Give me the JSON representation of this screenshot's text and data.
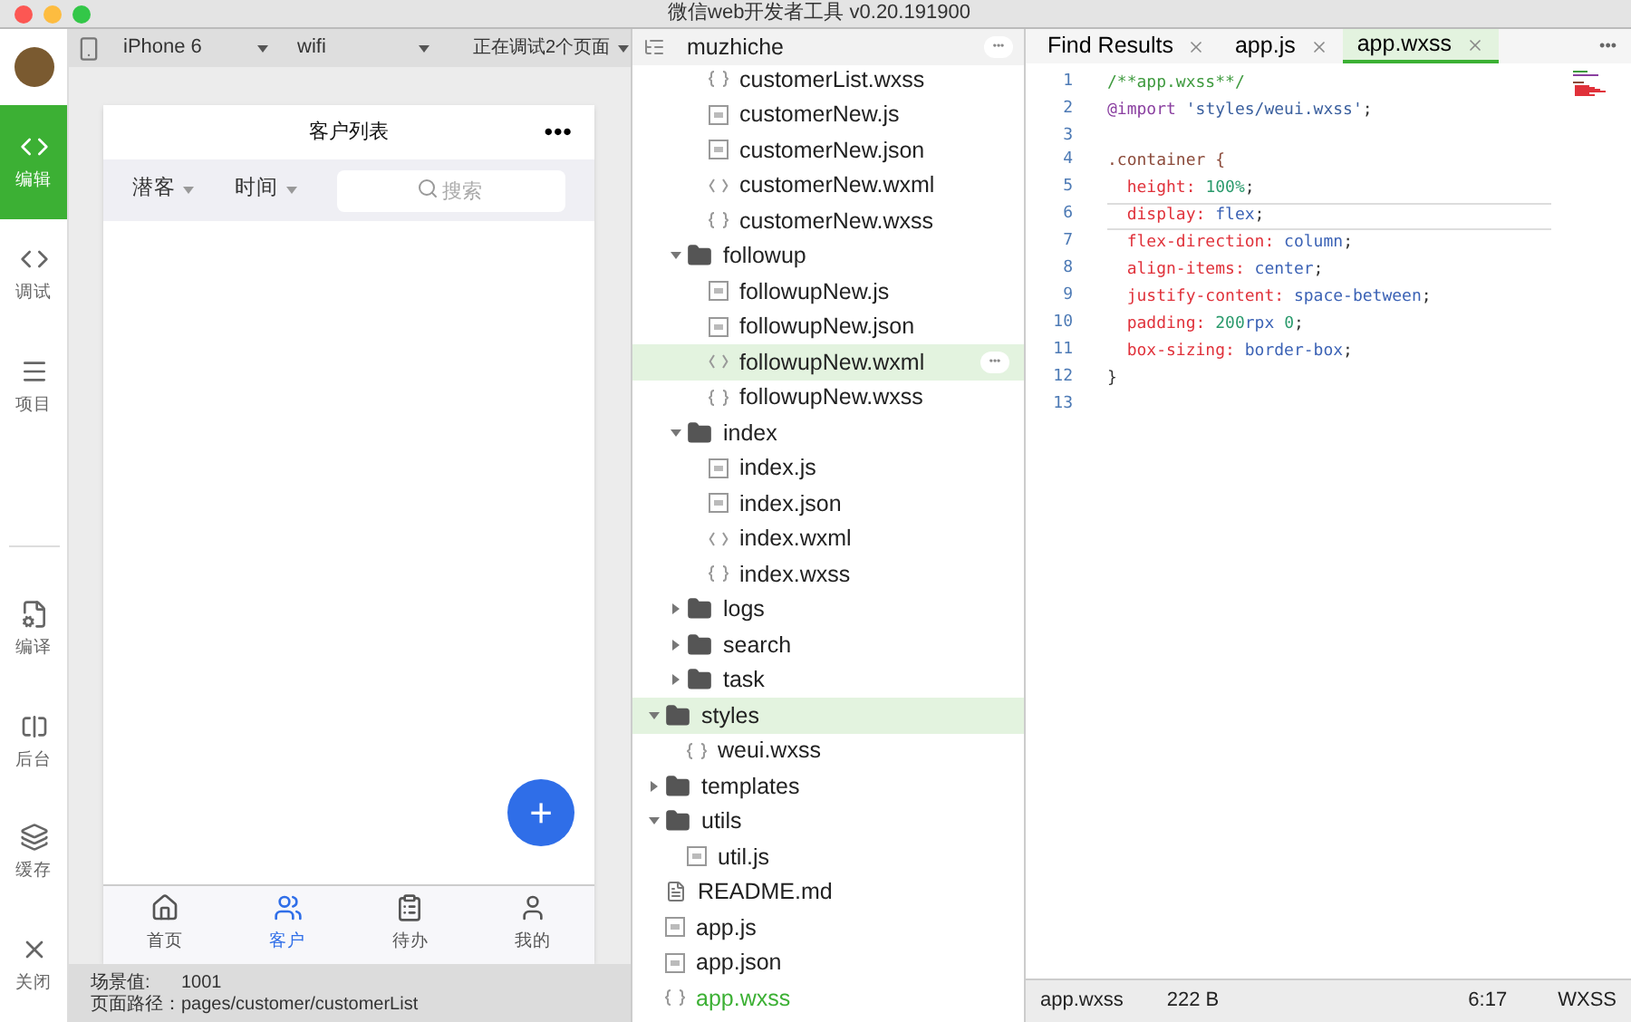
{
  "window": {
    "title": "微信web开发者工具 v0.20.191900"
  },
  "sidebar": {
    "items": [
      {
        "kind": "edit",
        "label": "编辑",
        "selected": true
      },
      {
        "kind": "debug",
        "label": "调试",
        "selected": false
      },
      {
        "kind": "project",
        "label": "项目",
        "selected": false
      },
      {
        "kind": "compile",
        "label": "编译",
        "selected": false
      },
      {
        "kind": "backend",
        "label": "后台",
        "selected": false
      },
      {
        "kind": "cache",
        "label": "缓存",
        "selected": false
      },
      {
        "kind": "close",
        "label": "关闭",
        "selected": false
      }
    ]
  },
  "simulator": {
    "device": "iPhone 6",
    "network": "wifi",
    "debug_pages": "正在调试2个页面",
    "page_title": "客户列表",
    "menu": "•••",
    "filters": [
      {
        "label": "潜客"
      },
      {
        "label": "时间"
      }
    ],
    "search": {
      "placeholder": "搜索"
    },
    "fab": "+",
    "tabbar": [
      {
        "kind": "home",
        "label": "首页",
        "selected": false
      },
      {
        "kind": "customers",
        "label": "客户",
        "selected": true
      },
      {
        "kind": "todo",
        "label": "待办",
        "selected": false
      },
      {
        "kind": "me",
        "label": "我的",
        "selected": false
      }
    ],
    "scene_label": "场景值:",
    "scene_value": "1001",
    "path_label": "页面路径：",
    "path_value": "pages/customer/customerList"
  },
  "file_tree": {
    "project": "muzhiche",
    "more": "•••",
    "items": [
      {
        "children": [
          {
            "children": [
              {
                "name": "customerList.wxss",
                "kind": "wxss",
                "selected": false
              },
              {
                "name": "customerNew.js",
                "kind": "js",
                "selected": false
              },
              {
                "name": "customerNew.json",
                "kind": "json",
                "selected": false
              },
              {
                "name": "customerNew.wxml",
                "kind": "wxml",
                "selected": false
              },
              {
                "name": "customerNew.wxss",
                "kind": "wxss",
                "selected": false
              }
            ]
          },
          {
            "name": "followup",
            "kind": "folder",
            "expanded": true,
            "selected": false,
            "children": [
              {
                "name": "followupNew.js",
                "kind": "js",
                "selected": false
              },
              {
                "name": "followupNew.json",
                "kind": "json",
                "selected": false
              },
              {
                "name": "followupNew.wxml",
                "kind": "wxml",
                "selected": true,
                "more": "•••"
              },
              {
                "name": "followupNew.wxss",
                "kind": "wxss",
                "selected": false
              }
            ]
          },
          {
            "name": "index",
            "kind": "folder",
            "expanded": true,
            "selected": false,
            "children": [
              {
                "name": "index.js",
                "kind": "js",
                "selected": false
              },
              {
                "name": "index.json",
                "kind": "json",
                "selected": false
              },
              {
                "name": "index.wxml",
                "kind": "wxml",
                "selected": false
              },
              {
                "name": "index.wxss",
                "kind": "wxss",
                "selected": false
              }
            ]
          },
          {
            "name": "logs",
            "kind": "folder",
            "expanded": false,
            "selected": false
          },
          {
            "name": "search",
            "kind": "folder",
            "expanded": false,
            "selected": false
          },
          {
            "name": "task",
            "kind": "folder",
            "expanded": false,
            "selected": false
          }
        ]
      },
      {
        "name": "styles",
        "kind": "folder",
        "expanded": true,
        "selected": true,
        "children": [
          {
            "name": "weui.wxss",
            "kind": "wxss",
            "selected": false
          }
        ]
      },
      {
        "name": "templates",
        "kind": "folder",
        "expanded": false,
        "selected": false
      },
      {
        "name": "utils",
        "kind": "folder",
        "expanded": true,
        "selected": false,
        "children": [
          {
            "name": "util.js",
            "kind": "js",
            "selected": false
          }
        ]
      },
      {
        "name": "README.md",
        "kind": "md",
        "selected": false
      },
      {
        "name": "app.js",
        "kind": "js",
        "selected": false
      },
      {
        "name": "app.json",
        "kind": "json",
        "selected": false
      },
      {
        "name": "app.wxss",
        "kind": "wxss",
        "selected": false,
        "current": true
      }
    ]
  },
  "editor": {
    "tabs": [
      {
        "label": "Find Results",
        "selected": false
      },
      {
        "label": "app.js",
        "selected": false
      },
      {
        "label": "app.wxss",
        "selected": true
      }
    ],
    "more": "•••",
    "lines": [
      {
        "number": "1",
        "current": false,
        "tokens": [
          {
            "kind": "comment",
            "text": "/**app.wxss**/"
          }
        ]
      },
      {
        "number": "2",
        "current": false,
        "tokens": [
          {
            "kind": "keyword",
            "text": "@import"
          },
          {
            "kind": "string",
            "text": " 'styles/weui.wxss'"
          },
          {
            "kind": "punct",
            "text": ";"
          }
        ]
      },
      {
        "number": "3",
        "current": false
      },
      {
        "number": "4",
        "current": false,
        "tokens": [
          {
            "kind": "selector",
            "text": ".container {"
          }
        ]
      },
      {
        "number": "5",
        "current": false,
        "tokens": [
          {
            "kind": "property",
            "text": "  height: "
          },
          {
            "kind": "number",
            "text": "100%"
          },
          {
            "kind": "punct",
            "text": ";"
          }
        ]
      },
      {
        "number": "6",
        "current": true,
        "tokens": [
          {
            "kind": "property",
            "text": "  display: "
          },
          {
            "kind": "value",
            "text": "flex"
          },
          {
            "kind": "punct",
            "text": ";"
          }
        ]
      },
      {
        "number": "7",
        "current": false,
        "tokens": [
          {
            "kind": "property",
            "text": "  flex-direction: "
          },
          {
            "kind": "value",
            "text": "column"
          },
          {
            "kind": "punct",
            "text": ";"
          }
        ]
      },
      {
        "number": "8",
        "current": false,
        "tokens": [
          {
            "kind": "property",
            "text": "  align-items: "
          },
          {
            "kind": "value",
            "text": "center"
          },
          {
            "kind": "punct",
            "text": ";"
          }
        ]
      },
      {
        "number": "9",
        "current": false,
        "tokens": [
          {
            "kind": "property",
            "text": "  justify-content: "
          },
          {
            "kind": "value",
            "text": "space-between"
          },
          {
            "kind": "punct",
            "text": ";"
          }
        ]
      },
      {
        "number": "10",
        "current": false,
        "tokens": [
          {
            "kind": "property",
            "text": "  padding: "
          },
          {
            "kind": "number",
            "text": "200"
          },
          {
            "kind": "value",
            "text": "rpx "
          },
          {
            "kind": "number",
            "text": "0"
          },
          {
            "kind": "punct",
            "text": ";"
          }
        ]
      },
      {
        "number": "11",
        "current": false,
        "tokens": [
          {
            "kind": "property",
            "text": "  box-sizing: "
          },
          {
            "kind": "value",
            "text": "border-box"
          },
          {
            "kind": "punct",
            "text": ";"
          }
        ]
      },
      {
        "number": "12",
        "current": false,
        "tokens": [
          {
            "kind": "punct",
            "text": "}"
          }
        ]
      },
      {
        "number": "13",
        "current": false
      }
    ]
  },
  "status_bar": {
    "file": "app.wxss",
    "size": "222 B",
    "position": "6:17",
    "language": "WXSS"
  }
}
